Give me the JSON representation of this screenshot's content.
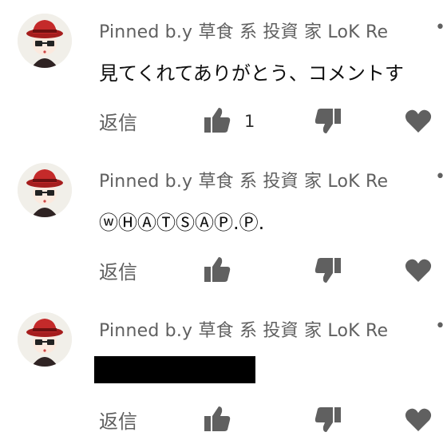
{
  "comments": [
    {
      "author": "Pinned b.y 草食 系 投資 家 LoK Re",
      "text": "見てくれてありがとう、コメントす",
      "redacted": false,
      "reply_label": "返信",
      "like_count": "1"
    },
    {
      "author": "Pinned b.y 草食 系 投資 家 LoK Re",
      "text": "ⓦⒽⒶⓉⓈⒶⓅ.Ⓟ.",
      "redacted": false,
      "reply_label": "返信",
      "like_count": ""
    },
    {
      "author": "Pinned b.y 草食 系 投資 家 LoK Re",
      "text": "",
      "redacted": true,
      "reply_label": "返信",
      "like_count": ""
    }
  ],
  "icons": {
    "like": "thumb-up-icon",
    "dislike": "thumb-down-icon",
    "heart": "heart-icon",
    "more": "more-vert-icon"
  },
  "colors": {
    "secondary_text": "#606060",
    "icon": "#606060",
    "avatar_hat": "#b22222"
  }
}
